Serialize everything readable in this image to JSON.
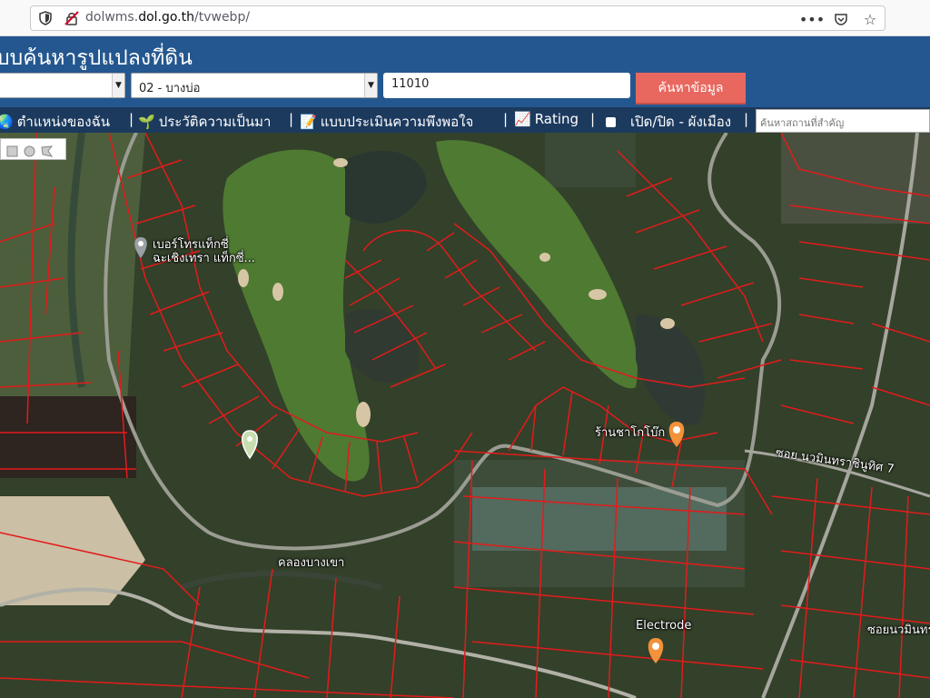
{
  "browser": {
    "url_host": "dolwms.",
    "url_domain": "dol.go.th",
    "url_path": "/tvwebp/"
  },
  "header": {
    "title": "บบค้นหารูปแปลงที่ดิน",
    "district_select": "02 - บางบ่อ",
    "parcel_input": "11010",
    "search_button": "ค้นหาข้อมูล"
  },
  "toolbar": {
    "my_location": "ตำแหน่งของฉัน",
    "history": "ประวัติความเป็นมา",
    "survey": "แบบประเมินความพึงพอใจ",
    "rating": "Rating",
    "toggle_plan": "เปิด/ปิด - ผังเมือง",
    "place_placeholder": "ค้นหาสถานที่สำคัญ",
    "separator": "|"
  },
  "map": {
    "labels": {
      "taxi_line1": "เบอร์โทรแท็กซี่",
      "taxi_line2": "ฉะเชิงเทรา แท็กซี่...",
      "tea_shop": "ร้านชาโกโบ๊ก",
      "soi_7": "ซอย นวมินทราชินูทิศ 7",
      "canal": "คลองบางเขา",
      "electrode": "Electrode",
      "soi_right": "ซอยนวมินทร"
    }
  },
  "colors": {
    "header_blue": "#24578f",
    "toolbar_navy": "#1c3a5e",
    "search_red": "#e8685f",
    "parcel_red": "#e31b1b"
  }
}
